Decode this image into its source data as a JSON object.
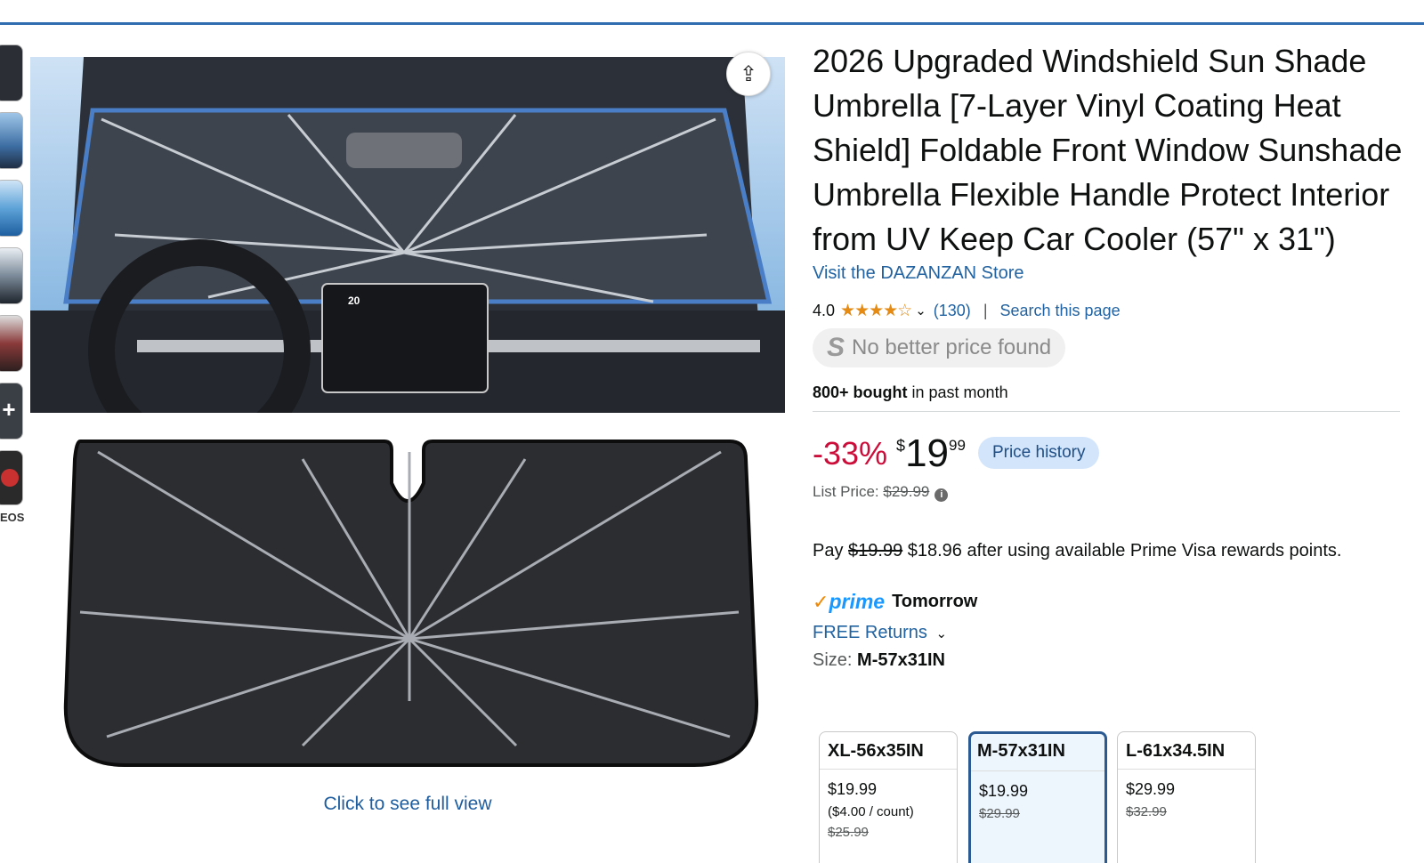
{
  "product": {
    "title": "2026 Upgraded Windshield Sun Shade Umbrella [7-Layer Vinyl Coating Heat Shield] Foldable Front Window Sunshade Umbrella Flexible Handle Protect Interior from UV Keep Car Cooler (57\" x 31\")",
    "store_link": "Visit the DAZANZAN Store",
    "rating": "4.0",
    "stars": "★★★★☆",
    "review_count": "(130)",
    "separator": "|",
    "search_link": "Search this page",
    "no_better_price": "No better price found",
    "no_better_logo": "S",
    "bought_bold": "800+ bought",
    "bought_rest": " in past month"
  },
  "price": {
    "discount": "-33%",
    "currency": "$",
    "dollars": "19",
    "cents": "99",
    "history_button": "Price history",
    "list_label": "List Price: ",
    "list_value": "$29.99",
    "info_icon": "i"
  },
  "rewards": {
    "pay_prefix": "Pay ",
    "pay_strike": "$19.99",
    "pay_rest": " $18.96 after using available Prime Visa rewards points."
  },
  "delivery": {
    "prime_check": "✓",
    "prime_word": "prime",
    "prime_day": "Tomorrow",
    "returns": "FREE Returns",
    "chevron": "⌄"
  },
  "size": {
    "label": "Size: ",
    "selected": "M-57x31IN",
    "options": [
      {
        "name": "XL-56x35IN",
        "price": "$19.99",
        "unit": "($4.00 / count)",
        "list": "$25.99"
      },
      {
        "name": "M-57x31IN",
        "price": "$19.99",
        "unit": "",
        "list": "$29.99"
      },
      {
        "name": "L-61x34.5IN",
        "price": "$29.99",
        "unit": "",
        "list": "$32.99"
      }
    ]
  },
  "gallery": {
    "videos_label": "EOS",
    "plus_label": "+",
    "full_view": "Click to see full view",
    "share_icon": "share-icon"
  },
  "colors": {
    "accent_blue": "#2162a1",
    "deal_red": "#cc0c39",
    "prime_blue": "#1a98ff",
    "star_orange": "#e58a12",
    "selected_border": "#2b5a93"
  }
}
